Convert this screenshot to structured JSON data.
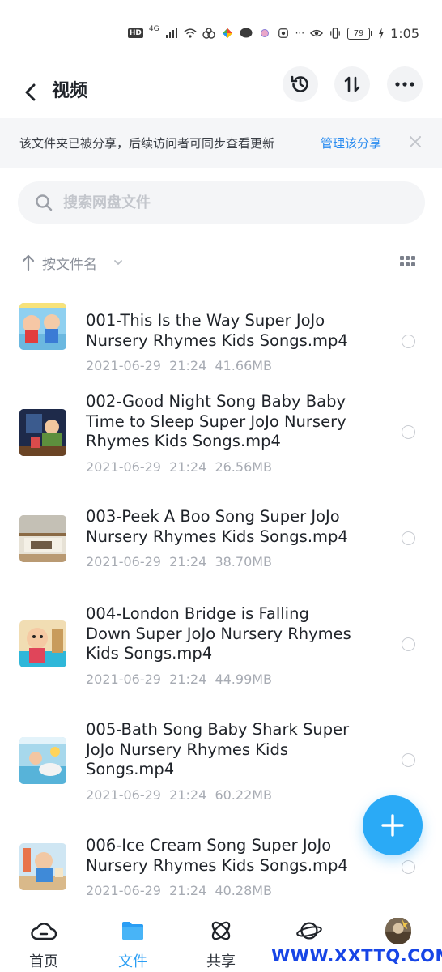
{
  "status_bar": {
    "hd_label": "HD",
    "network": "4G",
    "battery": "79",
    "time": "1:05"
  },
  "header": {
    "title": "视频",
    "back_icon": "chevron-left-icon",
    "history_icon": "history-icon",
    "sort_icon": "sort-updown-icon",
    "more_icon": "more-icon"
  },
  "banner": {
    "text": "该文件夹已被分享，后续访问者可同步查看更新",
    "link": "管理该分享"
  },
  "search": {
    "placeholder": "搜索网盘文件",
    "value": ""
  },
  "sort": {
    "label": "按文件名"
  },
  "files": [
    {
      "name": "001-This Is the Way  Super JoJo Nursery Rhymes  Kids Songs.mp4",
      "meta": "2021-06-29  21:24  41.66MB"
    },
    {
      "name": "002-Good Night Song  Baby Baby Time to Sleep  Super JoJo Nursery Rhymes  Kids Songs.mp4",
      "meta": "2021-06-29  21:24  26.56MB"
    },
    {
      "name": "003-Peek A Boo Song  Super JoJo Nursery Rhymes  Kids Songs.mp4",
      "meta": "2021-06-29  21:24  38.70MB"
    },
    {
      "name": "004-London Bridge is Falling Down  Super JoJo Nursery Rhymes  Kids Songs.mp4",
      "meta": "2021-06-29  21:24  44.99MB"
    },
    {
      "name": "005-Bath Song  Baby Shark  Super JoJo Nursery Rhymes  Kids Songs.mp4",
      "meta": "2021-06-29  21:24  60.22MB"
    },
    {
      "name": "006-Ice Cream Song  Super JoJo Nursery Rhymes  Kids Songs.mp4",
      "meta": "2021-06-29  21:24  40.28MB"
    }
  ],
  "nav": {
    "home": "首页",
    "files": "文件",
    "share": "共享",
    "discover": "",
    "me": ""
  },
  "colors": {
    "accent": "#2a9ef4",
    "fab": "#2aaaf6",
    "link": "#2a8cf0"
  },
  "watermark": "WWW.XXTTQ.COM"
}
